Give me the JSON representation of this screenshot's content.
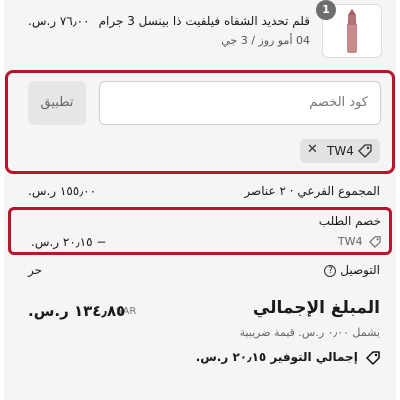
{
  "product": {
    "quantity": "1",
    "title": "قلم تحديد الشفاه فيلفيت ذا بينسل 3 جرام",
    "variant": "04 أمو روز / 3 جي",
    "price": "٧٦٫٠٠ ر.س.",
    "image_color": "#c98a8e"
  },
  "discount": {
    "placeholder": "كود الخصم",
    "apply_label": "تطبيق",
    "applied_code": "TW4",
    "remove_icon": "close-icon",
    "tag_icon": "tag-icon"
  },
  "summary": {
    "subtotal_label": "المجموع الفرعي · ٢ عناصر",
    "subtotal_value": "١٥٥٫٠٠ ر.س.",
    "order_discount_label": "خصم الطلب",
    "order_discount_code": "TW4",
    "order_discount_value": "− ٢٠٫١٥ ر.س.",
    "shipping_label": "التوصيل",
    "shipping_value": "حر",
    "total_label": "المبلغ الإجمالي",
    "total_currency": "SAR",
    "total_value": "١٣٤٫٨٥ ر.س.",
    "tax_note": "يشمل ٠٫٠٠ ر.س. قيمة ضريبية",
    "savings_label": "إجمالي التوفير ٢٠٫١٥ ر.س."
  },
  "colors": {
    "highlight": "#b7152d",
    "panel_bg": "#f5f5f5"
  }
}
